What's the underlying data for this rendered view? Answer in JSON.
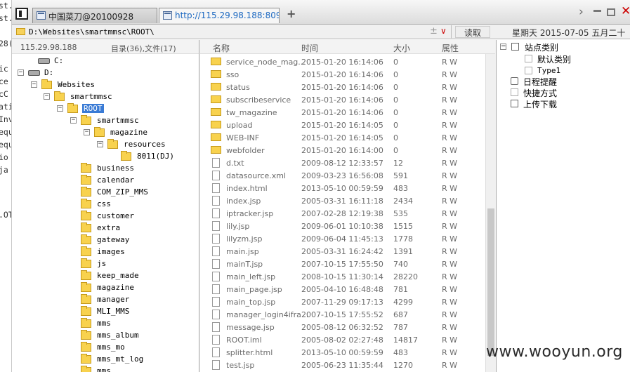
{
  "background_fragments": [
    "st.",
    "st.",
    "28(",
    "ic",
    "ce",
    "cC",
    "ati",
    "Inv",
    "equ",
    "equ",
    "io",
    "ja",
    ".OT"
  ],
  "tabs": [
    {
      "label": "中国菜刀@20100928"
    },
    {
      "label": "http://115.29.98.188:8090/s..."
    }
  ],
  "address": {
    "path": "D:\\Websites\\smartmmsc\\ROOT\\",
    "star": "±",
    "dropdown": "∨"
  },
  "read_button": "读取",
  "date_text": "星期天 2015-07-05 五月二十",
  "tree_header": {
    "ip": "115.29.98.188",
    "counts": "目录(36),文件(17)"
  },
  "tree": [
    {
      "label": "C:"
    },
    {
      "label": "D:"
    },
    {
      "label": "Websites"
    },
    {
      "label": "smartmmsc"
    },
    {
      "label": "ROOT"
    },
    {
      "label": "smartmmsc"
    },
    {
      "label": "magazine"
    },
    {
      "label": "resources"
    },
    {
      "label": "8011(DJ)"
    },
    {
      "label": "business"
    },
    {
      "label": "calendar"
    },
    {
      "label": "COM_ZIP_MMS"
    },
    {
      "label": "css"
    },
    {
      "label": "customer"
    },
    {
      "label": "extra"
    },
    {
      "label": "gateway"
    },
    {
      "label": "images"
    },
    {
      "label": "js"
    },
    {
      "label": "keep_made"
    },
    {
      "label": "magazine"
    },
    {
      "label": "manager"
    },
    {
      "label": "MLI_MMS"
    },
    {
      "label": "mms"
    },
    {
      "label": "mms_album"
    },
    {
      "label": "mms_mo"
    },
    {
      "label": "mms_mt_log"
    },
    {
      "label": "mms_..."
    }
  ],
  "columns": {
    "name": "名称",
    "time": "时间",
    "size": "大小",
    "attr": "属性"
  },
  "files": [
    {
      "name": "service_node_mag...",
      "time": "2015-01-20 16:14:06",
      "size": "0",
      "attr": "R W",
      "kind": "folder"
    },
    {
      "name": "sso",
      "time": "2015-01-20 16:14:06",
      "size": "0",
      "attr": "R W",
      "kind": "folder"
    },
    {
      "name": "status",
      "time": "2015-01-20 16:14:06",
      "size": "0",
      "attr": "R W",
      "kind": "folder"
    },
    {
      "name": "subscribeservice",
      "time": "2015-01-20 16:14:06",
      "size": "0",
      "attr": "R W",
      "kind": "folder"
    },
    {
      "name": "tw_magazine",
      "time": "2015-01-20 16:14:06",
      "size": "0",
      "attr": "R W",
      "kind": "folder"
    },
    {
      "name": "upload",
      "time": "2015-01-20 16:14:05",
      "size": "0",
      "attr": "R W",
      "kind": "folder"
    },
    {
      "name": "WEB-INF",
      "time": "2015-01-20 16:14:05",
      "size": "0",
      "attr": "R W",
      "kind": "folder"
    },
    {
      "name": "webfolder",
      "time": "2015-01-20 16:14:00",
      "size": "0",
      "attr": "R W",
      "kind": "folder"
    },
    {
      "name": "d.txt",
      "time": "2009-08-12 12:33:57",
      "size": "12",
      "attr": "R W",
      "kind": "file"
    },
    {
      "name": "datasource.xml",
      "time": "2009-03-23 16:56:08",
      "size": "591",
      "attr": "R W",
      "kind": "file"
    },
    {
      "name": "index.html",
      "time": "2013-05-10 00:59:59",
      "size": "483",
      "attr": "R W",
      "kind": "file"
    },
    {
      "name": "index.jsp",
      "time": "2005-03-31 16:11:18",
      "size": "2434",
      "attr": "R W",
      "kind": "file"
    },
    {
      "name": "iptracker.jsp",
      "time": "2007-02-28 12:19:38",
      "size": "535",
      "attr": "R W",
      "kind": "file"
    },
    {
      "name": "lily.jsp",
      "time": "2009-06-01 10:10:38",
      "size": "1515",
      "attr": "R W",
      "kind": "file"
    },
    {
      "name": "lilyzm.jsp",
      "time": "2009-06-04 11:45:13",
      "size": "1778",
      "attr": "R W",
      "kind": "file"
    },
    {
      "name": "main.jsp",
      "time": "2005-03-31 16:24:42",
      "size": "1391",
      "attr": "R W",
      "kind": "file"
    },
    {
      "name": "mainT.jsp",
      "time": "2007-10-15 17:55:50",
      "size": "740",
      "attr": "R W",
      "kind": "file"
    },
    {
      "name": "main_left.jsp",
      "time": "2008-10-15 11:30:14",
      "size": "28220",
      "attr": "R W",
      "kind": "file"
    },
    {
      "name": "main_page.jsp",
      "time": "2005-04-10 16:48:48",
      "size": "781",
      "attr": "R W",
      "kind": "file"
    },
    {
      "name": "main_top.jsp",
      "time": "2007-11-29 09:17:13",
      "size": "4299",
      "attr": "R W",
      "kind": "file"
    },
    {
      "name": "manager_login4ifra...",
      "time": "2007-10-15 17:55:52",
      "size": "687",
      "attr": "R W",
      "kind": "file"
    },
    {
      "name": "message.jsp",
      "time": "2005-08-12 06:32:52",
      "size": "787",
      "attr": "R W",
      "kind": "file"
    },
    {
      "name": "ROOT.iml",
      "time": "2005-08-02 02:27:48",
      "size": "14817",
      "attr": "R W",
      "kind": "file"
    },
    {
      "name": "splitter.html",
      "time": "2013-05-10 00:59:59",
      "size": "483",
      "attr": "R W",
      "kind": "file"
    },
    {
      "name": "test.jsp",
      "time": "2005-06-23 11:35:44",
      "size": "1270",
      "attr": "R W",
      "kind": "file"
    }
  ],
  "right_tree": {
    "site_category": "站点类别",
    "default_category": "默认类别",
    "type1": "Type1",
    "schedule": "日程提醒",
    "shortcuts": "快捷方式",
    "upload_download": "上传下载"
  },
  "watermark": "www.wooyun.org"
}
